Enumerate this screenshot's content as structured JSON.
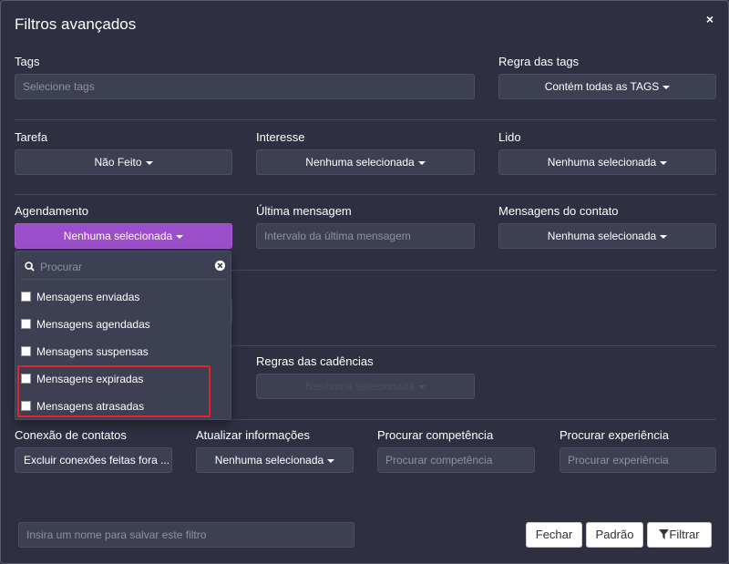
{
  "modal": {
    "title": "Filtros avançados",
    "close": "×"
  },
  "tags": {
    "label": "Tags",
    "placeholder": "Selecione tags"
  },
  "tag_rule": {
    "label": "Regra das tags",
    "value": "Contém todas as TAGS"
  },
  "task": {
    "label": "Tarefa",
    "value": "Não Feito"
  },
  "interest": {
    "label": "Interesse",
    "value": "Nenhuma selecionada"
  },
  "read": {
    "label": "Lido",
    "value": "Nenhuma selecionada"
  },
  "schedule": {
    "label": "Agendamento",
    "value": "Nenhuma selecionada"
  },
  "last_message": {
    "label": "Última mensagem",
    "placeholder": "Intervalo da última mensagem"
  },
  "contact_messages": {
    "label": "Mensagens do contato",
    "value": "Nenhuma selecionada"
  },
  "dropdown": {
    "search_placeholder": "Procurar",
    "items": [
      "Mensagens enviadas",
      "Mensagens agendadas",
      "Mensagens suspensas",
      "Mensagens expiradas",
      "Mensagens atrasadas"
    ]
  },
  "cadence_rules": {
    "label": "Regras das cadências",
    "value": "Nenhuma selecionada"
  },
  "contact_connection": {
    "label": "Conexão de contatos",
    "value": "Excluir conexões feitas fora ..."
  },
  "update_info": {
    "label": "Atualizar informações",
    "value": "Nenhuma selecionada"
  },
  "competence": {
    "label": "Procurar competência",
    "placeholder": "Procurar competência"
  },
  "experience": {
    "label": "Procurar experiência",
    "placeholder": "Procurar experiência"
  },
  "footer": {
    "filter_name_placeholder": "Insira um nome para salvar este filtro",
    "close_label": "Fechar",
    "default_label": "Padrão",
    "filter_label": "Filtrar"
  },
  "colors": {
    "background": "#2e3041",
    "field": "#3d3f53",
    "accent": "#9b4dca",
    "highlight": "#e0262b"
  },
  "icons": {
    "close": "close-icon",
    "search": "search-icon",
    "clear": "clear-icon",
    "caret": "caret-down-icon",
    "filter": "funnel-icon"
  }
}
